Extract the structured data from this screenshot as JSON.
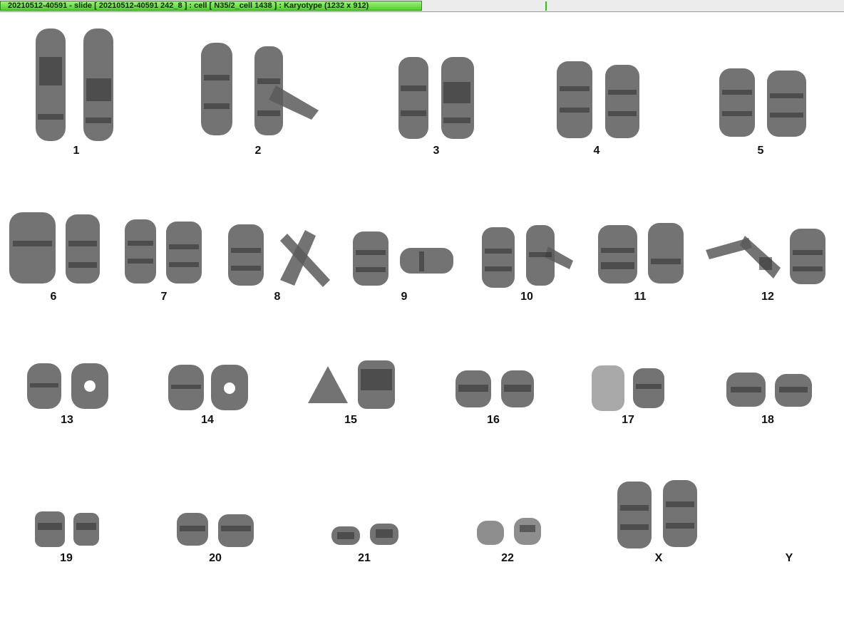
{
  "window": {
    "title": "20210512-40591 - slide [ 20210512-40591 242_8 ] : cell [ N35/2_cell 1438 ] : Karyotype  (1232 x 912)"
  },
  "karyotype": {
    "labels": {
      "c1": "1",
      "c2": "2",
      "c3": "3",
      "c4": "4",
      "c5": "5",
      "c6": "6",
      "c7": "7",
      "c8": "8",
      "c9": "9",
      "c10": "10",
      "c11": "11",
      "c12": "12",
      "c13": "13",
      "c14": "14",
      "c15": "15",
      "c16": "16",
      "c17": "17",
      "c18": "18",
      "c19": "19",
      "c20": "20",
      "c21": "21",
      "c22": "22",
      "cX": "X",
      "cY": "Y"
    },
    "chromosome_color": "#5a5a5a",
    "band_color": "#2e2e2e"
  }
}
